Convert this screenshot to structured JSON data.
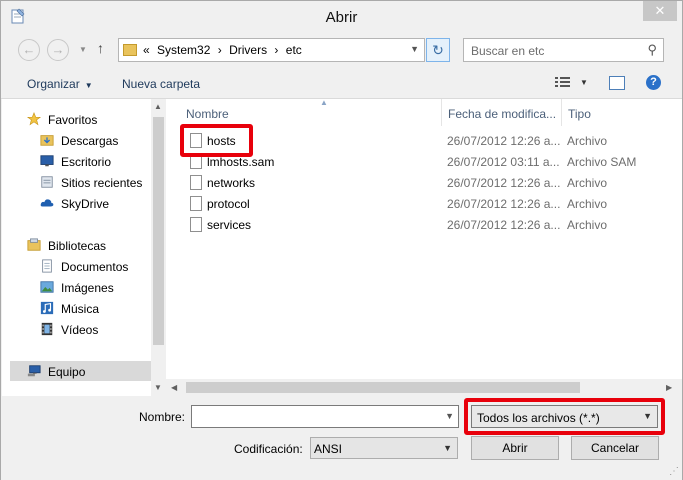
{
  "window": {
    "title": "Abrir",
    "close_glyph": "✕"
  },
  "navbar": {
    "back_glyph": "←",
    "forward_glyph": "→",
    "up_glyph": "↑",
    "crumb_prefix": "«",
    "crumbs": [
      "System32",
      "Drivers",
      "etc"
    ],
    "crumb_sep": "›",
    "refresh_glyph": "↻",
    "search_placeholder": "Buscar en etc",
    "search_glyph": "⚲"
  },
  "toolbar": {
    "organize": "Organizar",
    "new_folder": "Nueva carpeta",
    "help": "?"
  },
  "nav": {
    "favorites_label": "Favoritos",
    "favorites": [
      "Descargas",
      "Escritorio",
      "Sitios recientes",
      "SkyDrive"
    ],
    "libraries_label": "Bibliotecas",
    "libraries": [
      "Documentos",
      "Imágenes",
      "Música",
      "Vídeos"
    ],
    "computer_label": "Equipo"
  },
  "columns": {
    "name": "Nombre",
    "date": "Fecha de modifica...",
    "type": "Tipo"
  },
  "files": [
    {
      "name": "hosts",
      "date": "26/07/2012 12:26 a...",
      "type": "Archivo"
    },
    {
      "name": "lmhosts.sam",
      "date": "26/07/2012 03:11 a...",
      "type": "Archivo SAM"
    },
    {
      "name": "networks",
      "date": "26/07/2012 12:26 a...",
      "type": "Archivo"
    },
    {
      "name": "protocol",
      "date": "26/07/2012 12:26 a...",
      "type": "Archivo"
    },
    {
      "name": "services",
      "date": "26/07/2012 12:26 a...",
      "type": "Archivo"
    }
  ],
  "bottom": {
    "name_label": "Nombre:",
    "name_value": "",
    "filter_value": "Todos los archivos  (*.*)",
    "encoding_label": "Codificación:",
    "encoding_value": "ANSI",
    "open_button": "Abrir",
    "cancel_button": "Cancelar"
  },
  "colors": {
    "highlight": "#e8000b",
    "selected_nav": "#d9d9d9"
  }
}
